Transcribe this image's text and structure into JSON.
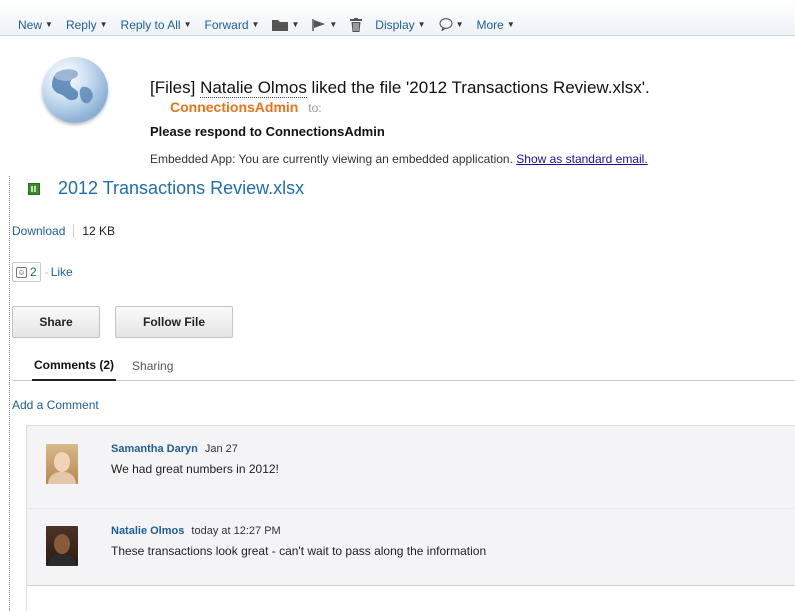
{
  "toolbar": {
    "new": "New",
    "reply": "Reply",
    "reply_all": "Reply to All",
    "forward": "Forward",
    "display": "Display",
    "more": "More"
  },
  "header": {
    "subject_prefix": "[Files] ",
    "subject_person": "Natalie Olmos",
    "subject_rest": " liked the file '2012 Transactions Review.xlsx'.",
    "from_name": "ConnectionsAdmin",
    "to_label": "to:",
    "respond": "Please respond to ConnectionsAdmin",
    "embedded_text": "Embedded App: You are currently viewing an embedded application. ",
    "embedded_link": "Show as standard email."
  },
  "file": {
    "name": "2012 Transactions Review.xlsx",
    "download": "Download",
    "size": "12 KB",
    "like_count": "2",
    "like_label": "Like"
  },
  "buttons": {
    "share": "Share",
    "follow": "Follow File"
  },
  "tabs": [
    {
      "label": "Comments (2)",
      "active": true
    },
    {
      "label": "Sharing",
      "active": false
    }
  ],
  "add_comment": "Add a Comment",
  "comments": [
    {
      "author": "Samantha Daryn",
      "date": "Jan 27",
      "text": "We had great numbers in 2012!"
    },
    {
      "author": "Natalie Olmos",
      "date": "today at 12:27 PM",
      "text": "These transactions look great - can't wait to pass along the information"
    }
  ],
  "colors": {
    "link": "#1e5d99",
    "from_name": "#e8741a",
    "file_title": "#1e6db5"
  }
}
